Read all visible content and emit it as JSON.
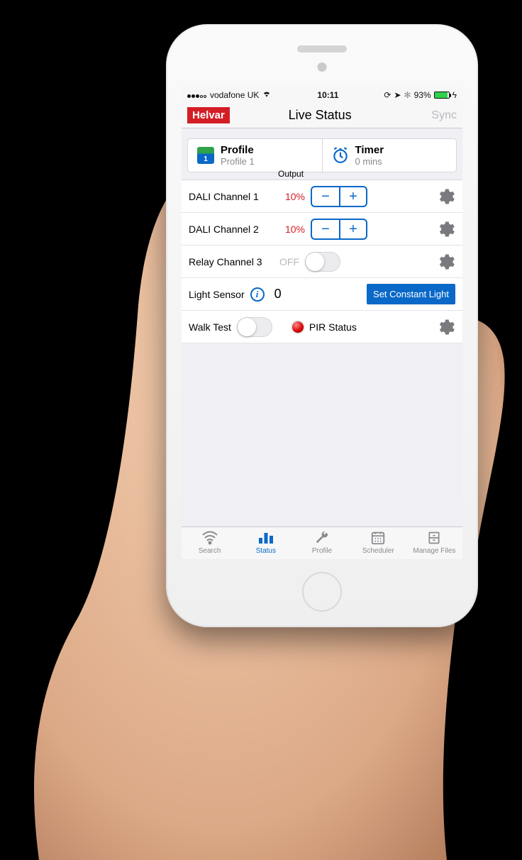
{
  "statusbar": {
    "carrier": "vodafone UK",
    "time": "10:11",
    "battery_pct": "93%"
  },
  "nav": {
    "brand": "Helvar",
    "title": "Live Status",
    "sync": "Sync"
  },
  "header": {
    "profile_label": "Profile",
    "profile_value": "Profile 1",
    "timer_label": "Timer",
    "timer_value": "0 mins"
  },
  "output_header": "Output",
  "channels": [
    {
      "name": "DALI Channel 1",
      "value": "10%"
    },
    {
      "name": "DALI Channel 2",
      "value": "10%"
    }
  ],
  "relay": {
    "name": "Relay Channel 3",
    "state_text": "OFF"
  },
  "light_sensor": {
    "label": "Light Sensor",
    "value": "0",
    "button": "Set Constant Light"
  },
  "walk_test": {
    "label": "Walk Test",
    "pir_label": "PIR Status"
  },
  "tabs": {
    "search": "Search",
    "status": "Status",
    "profile": "Profile",
    "scheduler": "Scheduler",
    "manage": "Manage Files"
  }
}
